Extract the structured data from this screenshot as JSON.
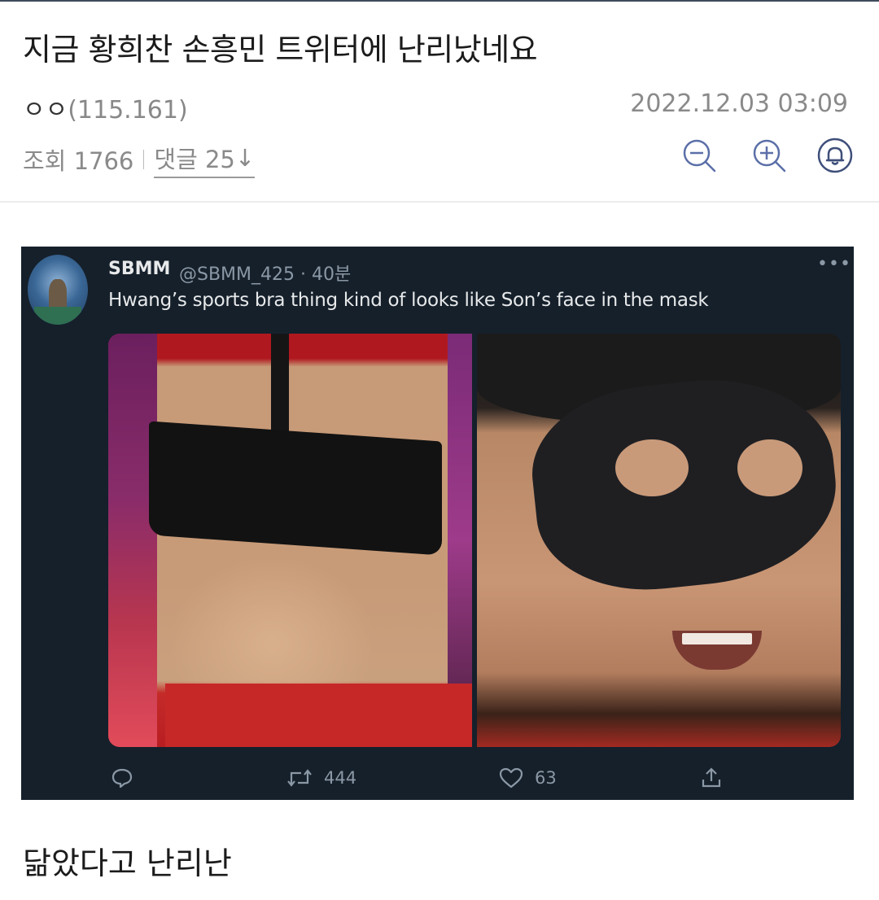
{
  "post": {
    "title": "지금 황희찬 손흥민 트위터에 난리났네요",
    "author": "ㅇㅇ",
    "author_ip": "(115.161)",
    "date": "2022.12.03 03:09",
    "views_label": "조회 1766",
    "comments_label": "댓글 25",
    "comments_arrow": "↓",
    "body": "닮았다고 난리난"
  },
  "toolbar": {
    "zoom_out_icon": "zoom-out-icon",
    "zoom_in_icon": "zoom-in-icon",
    "notify_icon": "bell-icon",
    "accent": "#5b6fa8"
  },
  "tweet": {
    "name": "SBMM",
    "handle_time": "@SBMM_425 · 40분",
    "more": "•••",
    "text": "Hwang’s sports bra thing kind of looks like Son’s face in the mask",
    "retweets": "444",
    "likes": "63",
    "bg_color": "#15202b"
  }
}
